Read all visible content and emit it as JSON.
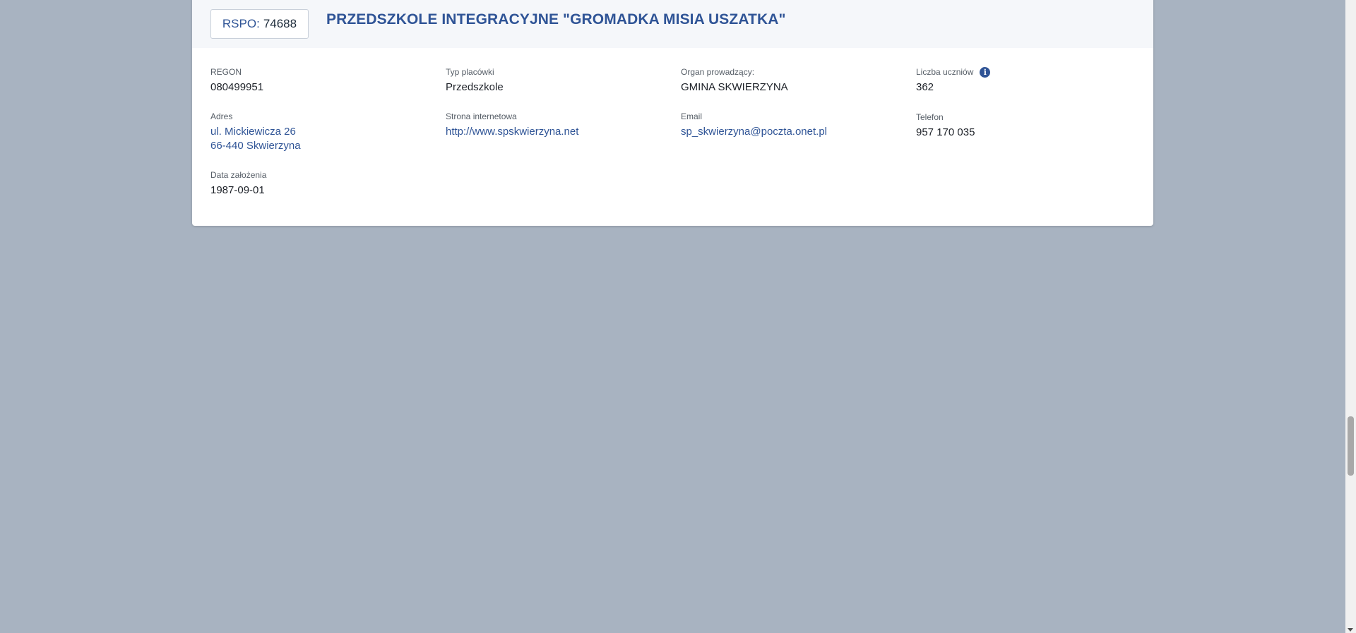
{
  "school": {
    "rspo_label": "RSPO:",
    "rspo_value": "74688",
    "name": "PRZEDSZKOLE INTEGRACYJNE \"GROMADKA MISIA USZATKA\""
  },
  "fields": {
    "regon": {
      "label": "REGON",
      "value": "080499951"
    },
    "typ": {
      "label": "Typ placówki",
      "value": "Przedszkole"
    },
    "organ": {
      "label": "Organ prowadzący:",
      "value": "GMINA SKWIERZYNA"
    },
    "liczba": {
      "label": "Liczba uczniów",
      "value": "362",
      "info_icon": "i"
    },
    "adres": {
      "label": "Adres",
      "line1": "ul. Mickiewicza 26",
      "line2": "66-440 Skwierzyna"
    },
    "strona": {
      "label": "Strona internetowa",
      "value": "http://www.spskwierzyna.net"
    },
    "email": {
      "label": "Email",
      "value": "sp_skwierzyna@poczta.onet.pl"
    },
    "telefon": {
      "label": "Telefon",
      "value": "957 170 035"
    },
    "data_zalozenia": {
      "label": "Data założenia",
      "value": "1987-09-01"
    }
  },
  "colors": {
    "background": "#a8b3c1",
    "accent": "#2f5496",
    "card": "#ffffff"
  }
}
